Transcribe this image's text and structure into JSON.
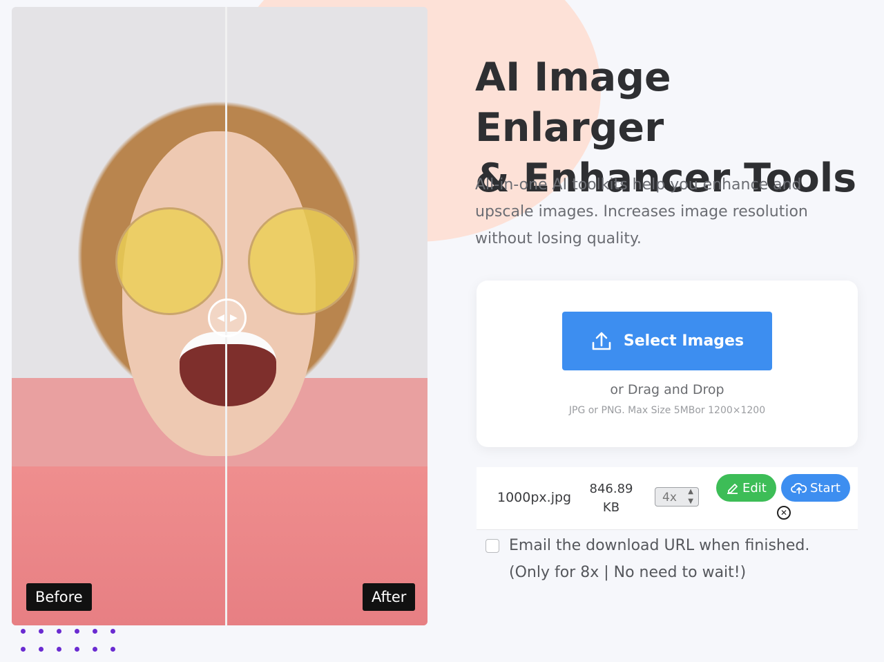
{
  "hero": {
    "title_line1": "AI Image Enlarger",
    "title_line2": "& Enhancer Tools",
    "subtitle": "All-in-one AI toolkits help you enhance and upscale images. Increases image resolution without losing quality."
  },
  "comparison": {
    "before_label": "Before",
    "after_label": "After"
  },
  "upload": {
    "button_label": "Select Images",
    "drag_text": "or Drag and Drop",
    "hint": "JPG or PNG. Max Size 5MBor 1200×1200"
  },
  "file": {
    "name": "1000px.jpg",
    "size_value": "846.89",
    "size_unit": "KB",
    "scale": "4x",
    "edit_label": "Edit",
    "start_label": "Start"
  },
  "email_option": {
    "label_line1": "Email the download URL when finished.",
    "label_line2": "(Only for 8x | No need to wait!)",
    "checked": false
  },
  "colors": {
    "primary_blue": "#3d8ef0",
    "edit_green": "#3dbd57",
    "dot_purple": "#6a2bd1",
    "blob_peach": "#fde1d7"
  }
}
